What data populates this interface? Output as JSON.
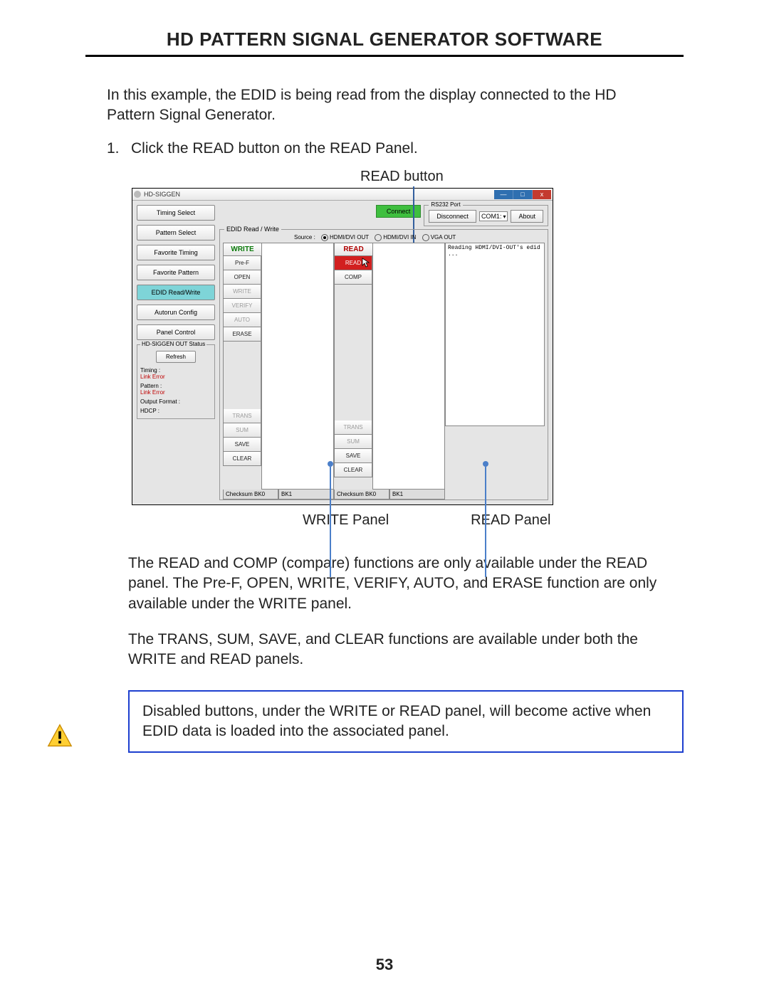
{
  "header": {
    "title": "HD PATTERN SIGNAL GENERATOR SOFTWARE"
  },
  "intro": "In this example, the EDID is being read from the display connected to the HD Pattern Signal Generator.",
  "step1_num": "1.",
  "step1_text": "Click the READ button on the READ Panel.",
  "callout_top": "READ button",
  "callout_write": "WRITE Panel",
  "callout_read": "READ Panel",
  "win": {
    "title": "HD-SIGGEN",
    "min": "—",
    "max": "□",
    "close": "x"
  },
  "sidebar": {
    "items": [
      "Timing Select",
      "Pattern Select",
      "Favorite Timing",
      "Favorite Pattern",
      "EDID Read/Write",
      "Autorun Config",
      "Panel Control"
    ],
    "status_title": "HD-SIGGEN OUT Status",
    "refresh": "Refresh",
    "rows": [
      {
        "label": "Timing :",
        "value": "Link Error"
      },
      {
        "label": "Pattern :",
        "value": "Link Error"
      },
      {
        "label": "Output Format :",
        "value": ""
      },
      {
        "label": "HDCP :",
        "value": ""
      }
    ]
  },
  "port": {
    "title": "RS232 Port",
    "connect": "Connect",
    "disconnect": "Disconnect",
    "com": "COM1:",
    "about": "About"
  },
  "edid": {
    "title": "EDID Read / Write",
    "source_label": "Source :",
    "src1": "HDMI/DVI OUT",
    "src2": "HDMI/DVI IN",
    "src3": "VGA OUT",
    "write_head": "WRITE",
    "read_head": "READ",
    "write_btns": [
      "Pre-F",
      "OPEN",
      "WRITE",
      "VERIFY",
      "AUTO",
      "ERASE"
    ],
    "read_btn_top": "READ",
    "read_btn_comp": "COMP",
    "common_btns": [
      "TRANS",
      "SUM",
      "SAVE",
      "CLEAR"
    ],
    "ck_bk0": "Checksum BK0",
    "ck_bk1": "BK1",
    "log": "Reading HDMI/DVI-OUT's edid\n..."
  },
  "para1": "The READ and COMP (compare) functions are only available under the READ panel.  The Pre-F, OPEN, WRITE, VERIFY, AUTO, and ERASE function are only available under the WRITE panel.",
  "para2": "The TRANS, SUM, SAVE, and CLEAR functions are available under both the WRITE and READ panels.",
  "warn": "Disabled buttons, under the WRITE or READ panel, will become active when EDID data is loaded into the associated panel.",
  "page_num": "53"
}
